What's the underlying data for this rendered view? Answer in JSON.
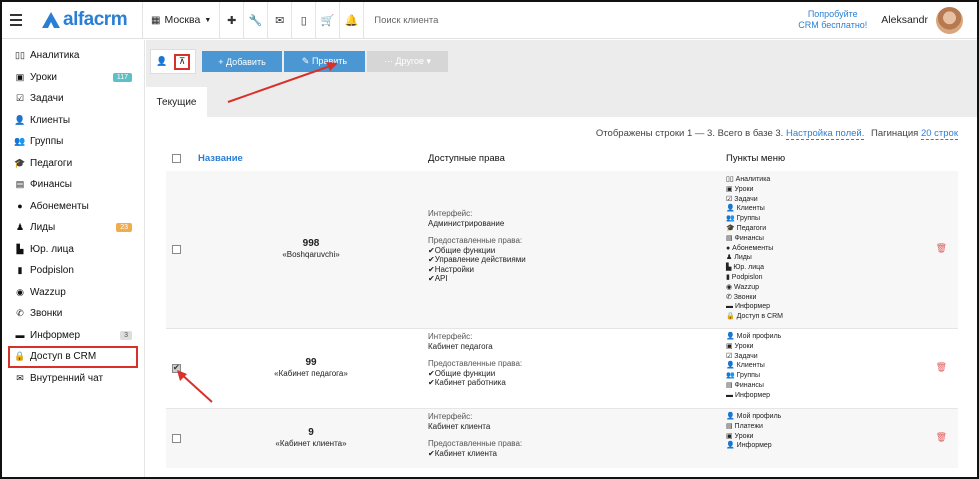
{
  "topbar": {
    "logo": "alfacrm",
    "city": "Москва",
    "search_placeholder": "Поиск клиента",
    "promo_line1": "Попробуйте",
    "promo_line2": "CRM бесплатно!",
    "user": "Aleksandr"
  },
  "sidebar": {
    "items": [
      {
        "label": "Аналитика",
        "icon": "chart-icon",
        "glyph": "▯▯"
      },
      {
        "label": "Уроки",
        "icon": "calendar-icon",
        "glyph": "▣",
        "badge": "117",
        "badge_color": "#5bc0c8"
      },
      {
        "label": "Задачи",
        "icon": "tasks-icon",
        "glyph": "☑"
      },
      {
        "label": "Клиенты",
        "icon": "user-icon",
        "glyph": "👤"
      },
      {
        "label": "Группы",
        "icon": "group-icon",
        "glyph": "👥"
      },
      {
        "label": "Педагоги",
        "icon": "graduation-icon",
        "glyph": "🎓"
      },
      {
        "label": "Финансы",
        "icon": "money-icon",
        "glyph": "▤"
      },
      {
        "label": "Абонементы",
        "icon": "subscription-icon",
        "glyph": "●"
      },
      {
        "label": "Лиды",
        "icon": "lead-icon",
        "glyph": "♟",
        "badge": "23",
        "badge_color": "#f0ad4e"
      },
      {
        "label": "Юр. лица",
        "icon": "building-icon",
        "glyph": "▙"
      },
      {
        "label": "Podpislon",
        "icon": "document-icon",
        "glyph": "▮"
      },
      {
        "label": "Wazzup",
        "icon": "whatsapp-icon",
        "glyph": "◉"
      },
      {
        "label": "Звонки",
        "icon": "phone-icon",
        "glyph": "✆"
      },
      {
        "label": "Информер",
        "icon": "informer-icon",
        "glyph": "▬",
        "badge": "3",
        "badge_color": "#dddddd"
      },
      {
        "label": "Доступ в CRM",
        "icon": "lock-icon",
        "glyph": "🔒",
        "highlight": true
      },
      {
        "label": "Внутренний чат",
        "icon": "chat-icon",
        "glyph": "✉"
      }
    ]
  },
  "toolbar": {
    "add_label": "+ Добавить",
    "edit_label": "✎ Править",
    "other_label": "··· Другое ▾"
  },
  "tab_current": "Текущие",
  "info": {
    "text": "Отображены строки 1 — 3. Всего в базе 3.",
    "fields_link": "Настройка полей.",
    "pagination_label": "Пагинация",
    "pagination_value": "20 строк"
  },
  "table": {
    "col_name": "Название",
    "col_rights": "Доступные права",
    "col_menu": "Пункты меню",
    "rows": [
      {
        "num": "998",
        "name": "«Boshqaruvchi»",
        "interface_label": "Интерфейс:",
        "interface_value": "Администрирование",
        "rights_label": "Предоставленные права:",
        "rights": [
          "✔Общие функции",
          "✔Управление действиями",
          "✔Настройки",
          "✔API"
        ],
        "menu": [
          "▯▯ Аналитика",
          "▣ Уроки",
          "☑ Задачи",
          "👤 Клиенты",
          "👥 Группы",
          "🎓 Педагоги",
          "▤ Финансы",
          "● Абонементы",
          "♟ Лиды",
          "▙ Юр. лица",
          "▮ Podpislon",
          "◉ Wazzup",
          "✆ Звонки",
          "▬ Информер",
          "🔒 Доступ в CRM"
        ],
        "checked": false
      },
      {
        "num": "99",
        "name": "«Кабинет педагога»",
        "interface_label": "Интерфейс:",
        "interface_value": "Кабинет педагога",
        "rights_label": "Предоставленные права:",
        "rights": [
          "✔Общие функции",
          "✔Кабинет работника"
        ],
        "menu": [
          "👤 Мой профиль",
          "▣ Уроки",
          "☑ Задачи",
          "👤 Клиенты",
          "👥 Группы",
          "▤ Финансы",
          "▬ Информер"
        ],
        "checked": true
      },
      {
        "num": "9",
        "name": "«Кабинет клиента»",
        "interface_label": "Интерфейс:",
        "interface_value": "Кабинет клиента",
        "rights_label": "Предоставленные права:",
        "rights": [
          "✔Кабинет клиента"
        ],
        "menu": [
          "👤 Мой профиль",
          "▤ Платежи",
          "▣ Уроки",
          "👤 Информер"
        ],
        "checked": false
      }
    ]
  },
  "colors": {
    "accent": "#2a7fd4",
    "button_blue": "#4a97d3",
    "highlight_red": "#d9302a",
    "trash": "#e05b5b"
  }
}
